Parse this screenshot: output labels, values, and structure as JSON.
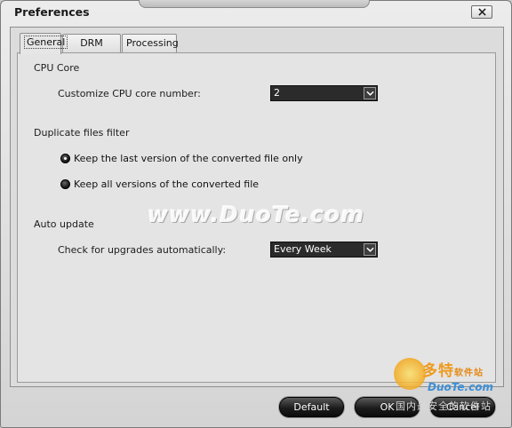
{
  "window": {
    "title": "Preferences"
  },
  "tabs": [
    {
      "label": "General",
      "active": true
    },
    {
      "label": "DRM Finder",
      "active": false
    },
    {
      "label": "Processing",
      "active": false
    }
  ],
  "cpu": {
    "section_title": "CPU Core",
    "label": "Customize CPU core number:",
    "value": "2"
  },
  "duplicate": {
    "section_title": "Duplicate files filter",
    "options": [
      {
        "label": "Keep the last version of the converted file only",
        "checked": true
      },
      {
        "label": "Keep all versions of the converted file",
        "checked": false
      }
    ]
  },
  "auto_update": {
    "section_title": "Auto update",
    "label": "Check for upgrades automatically:",
    "value": "Every Week"
  },
  "buttons": {
    "default": "Default",
    "ok": "OK",
    "cancel": "Cancel"
  },
  "watermark": {
    "text": "www.DuoTe.com",
    "logo_cn": "多特",
    "logo_cn_small": "软件站",
    "logo_en": "DuoTe.com",
    "logo_sub": "国内最安全的软件站"
  }
}
